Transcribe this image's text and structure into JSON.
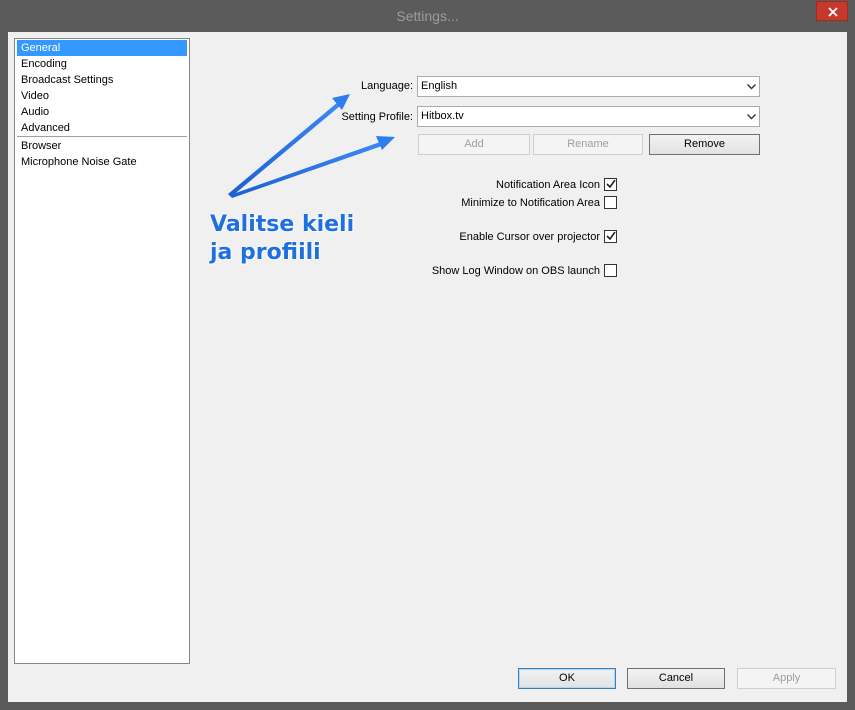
{
  "window": {
    "title": "Settings..."
  },
  "sidebar": {
    "items": [
      {
        "label": "General",
        "selected": true
      },
      {
        "label": "Encoding"
      },
      {
        "label": "Broadcast Settings"
      },
      {
        "label": "Video"
      },
      {
        "label": "Audio"
      },
      {
        "label": "Advanced"
      },
      {
        "label": "Browser"
      },
      {
        "label": "Microphone Noise Gate"
      }
    ]
  },
  "general": {
    "language_label": "Language:",
    "language_value": "English",
    "profile_label": "Setting Profile:",
    "profile_value": "Hitbox.tv",
    "add_label": "Add",
    "rename_label": "Rename",
    "remove_label": "Remove",
    "options": [
      {
        "label": "Notification Area Icon",
        "checked": true
      },
      {
        "label": "Minimize to Notification Area",
        "checked": false
      },
      {
        "label": "Enable Cursor over projector",
        "checked": true
      },
      {
        "label": "Show Log Window on OBS launch",
        "checked": false
      }
    ]
  },
  "annotation": {
    "line1": "Valitse kieli",
    "line2": "ja profiili",
    "color": "#1e6fe0"
  },
  "footer": {
    "ok_label": "OK",
    "cancel_label": "Cancel",
    "apply_label": "Apply"
  },
  "colors": {
    "selection": "#3399ff",
    "close_button": "#c7382c"
  }
}
